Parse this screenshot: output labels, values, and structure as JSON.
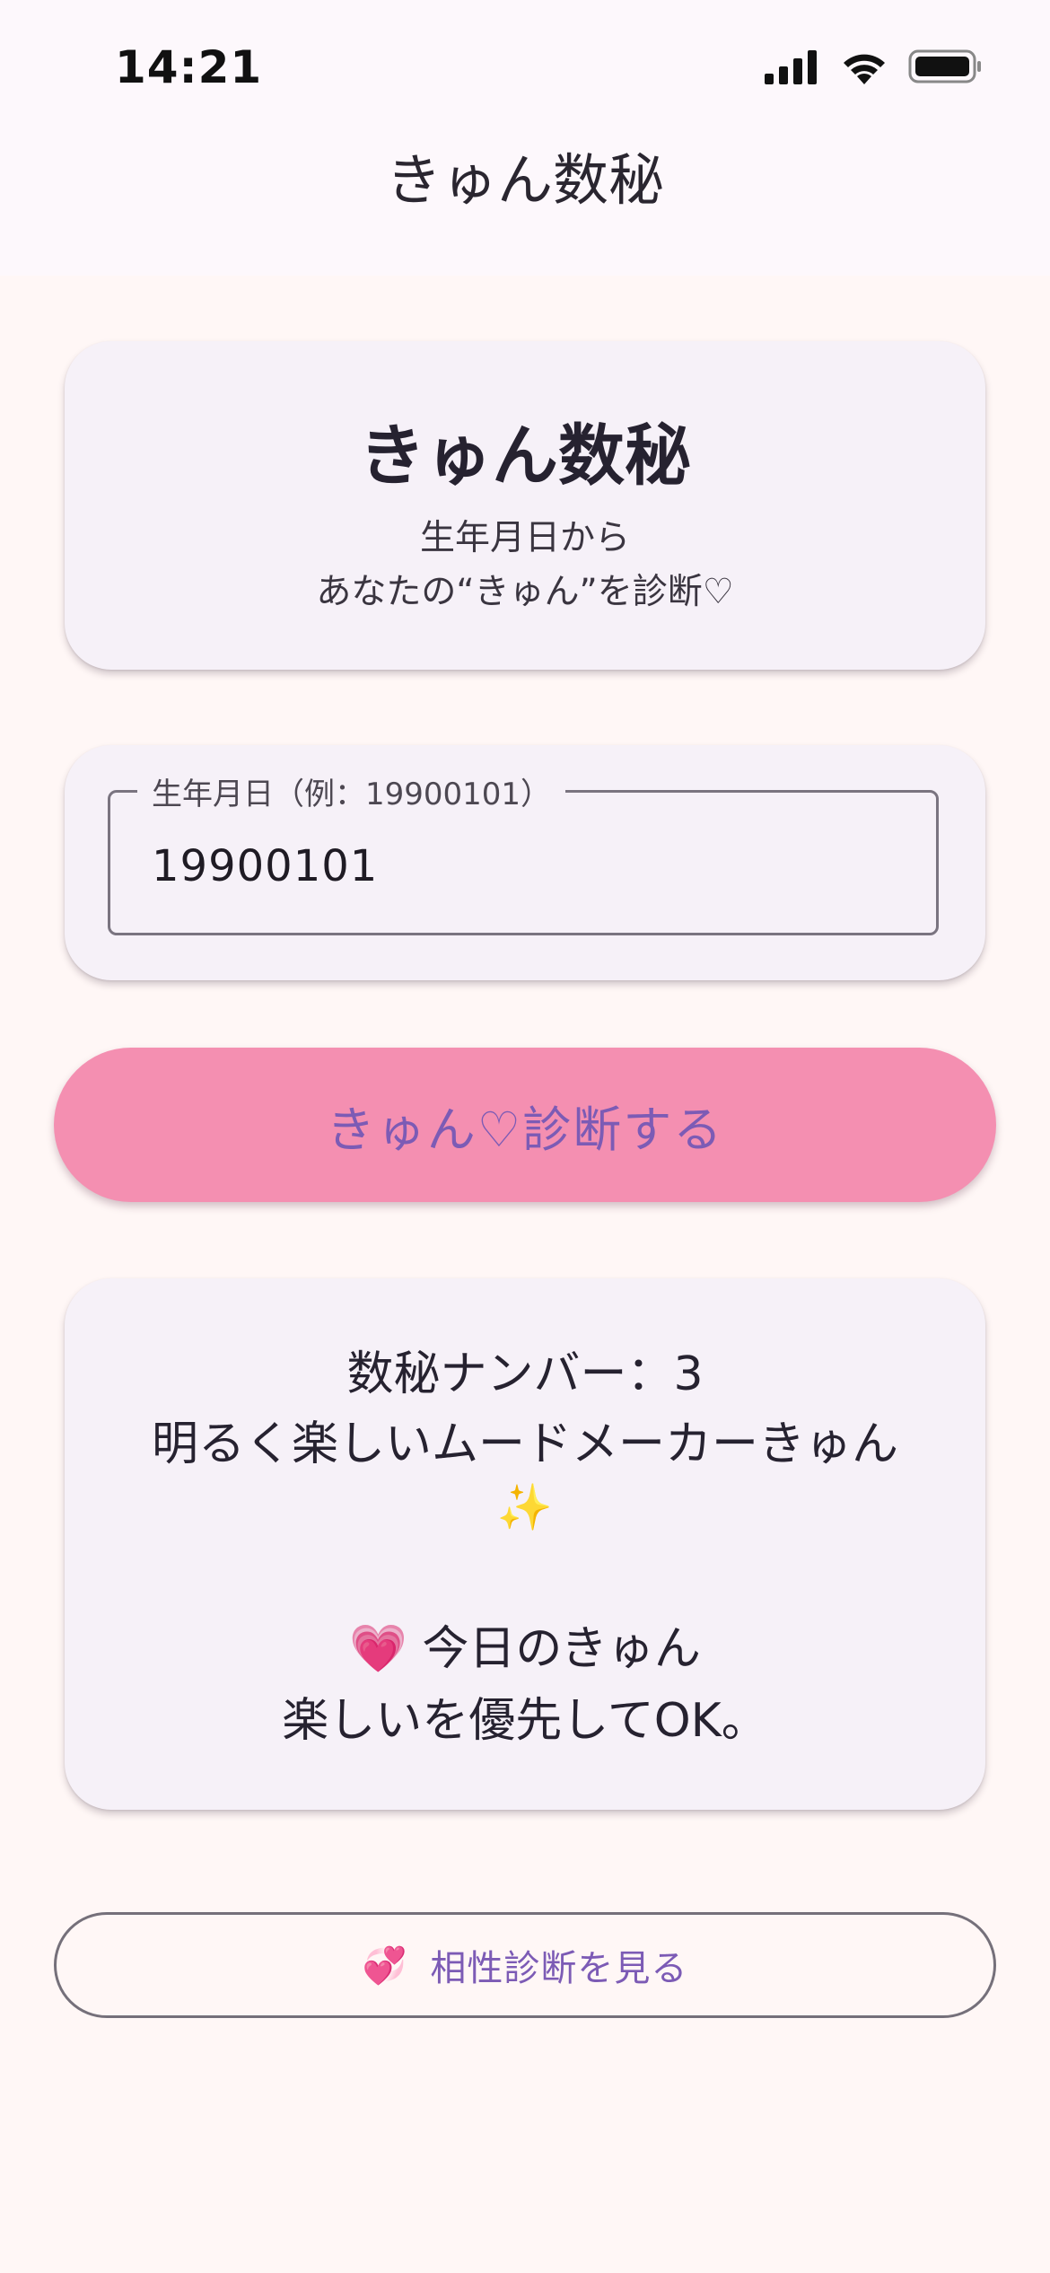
{
  "status_bar": {
    "time": "14:21",
    "icons": [
      "cellular-signal-icon",
      "wifi-icon",
      "battery-icon"
    ]
  },
  "app_bar": {
    "title": "きゅん数秘"
  },
  "header_card": {
    "title": "きゅん数秘",
    "subtitle_line1": "生年月日から",
    "subtitle_line2": "あなたの“きゅん”を診断♡"
  },
  "birthdate_field": {
    "label": "生年月日（例：19900101）",
    "value": "19900101"
  },
  "diagnose_button": {
    "label": "きゅん♡診断する"
  },
  "result": {
    "number_line": "数秘ナンバー：3",
    "type_line": "明るく楽しいムードメーカーきゅん",
    "sparkle": "✨",
    "today_heart": "💗",
    "today_title": "今日のきゅん",
    "today_message": "楽しいを優先してOK。"
  },
  "compatibility_button": {
    "icon": "💞",
    "label": "相性診断を見る"
  },
  "colors": {
    "background": "#FFF7F6",
    "card": "#F6F1F8",
    "primary_button": "#F48FB1",
    "accent_text": "#7C5BB5"
  }
}
